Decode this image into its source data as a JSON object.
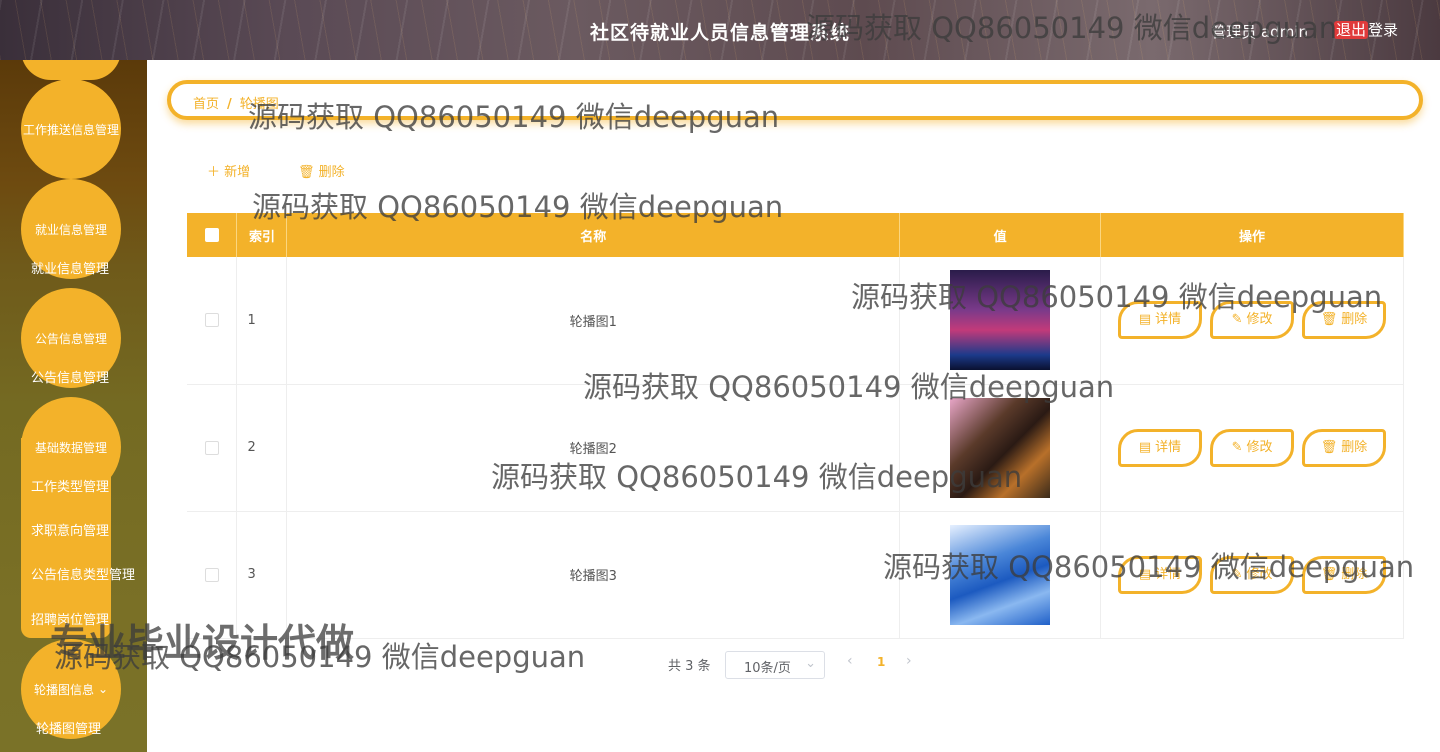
{
  "header": {
    "title": "社区待就业人员信息管理系统",
    "user_label": "管理员 admin",
    "logout_highlight": "退出",
    "logout_rest": "登录"
  },
  "sidebar": {
    "top_partial": "",
    "items": [
      {
        "bubble": "工作推送信息管理",
        "subs": []
      },
      {
        "bubble": "就业信息管理",
        "subs": [
          "就业信息管理"
        ]
      },
      {
        "bubble": "公告信息管理",
        "subs": [
          "公告信息管理"
        ]
      },
      {
        "bubble": "基础数据管理",
        "subs": [
          "工作类型管理",
          "求职意向管理",
          "公告信息类型管理",
          "招聘岗位管理"
        ]
      },
      {
        "bubble": "轮播图信息",
        "subs": [
          "轮播图管理"
        ]
      }
    ]
  },
  "breadcrumb": {
    "home": "首页",
    "current": "轮播图"
  },
  "toolbar": {
    "add_label": "新增",
    "delete_label": "删除"
  },
  "table": {
    "columns": [
      "索引",
      "名称",
      "值",
      "操作"
    ],
    "rows": [
      {
        "index": "1",
        "name": "轮播图1"
      },
      {
        "index": "2",
        "name": "轮播图2"
      },
      {
        "index": "3",
        "name": "轮播图3"
      }
    ],
    "actions": {
      "detail": "详情",
      "edit": "修改",
      "delete": "删除"
    }
  },
  "pagination": {
    "total": "共 3 条",
    "page_size": "10条/页",
    "current_page": "1"
  },
  "watermarks": {
    "text": "源码获取 QQ86050149 微信deepguan",
    "big": "专业毕业设计代做"
  },
  "colors": {
    "accent": "#f3b22a",
    "sidebar": "#6f5a1a"
  }
}
